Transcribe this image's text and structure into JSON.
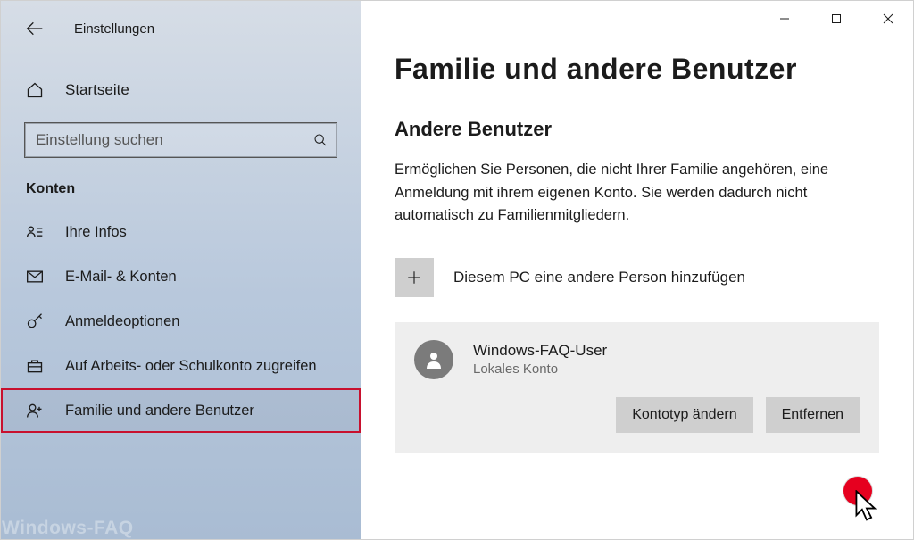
{
  "window": {
    "title": "Einstellungen"
  },
  "sidebar": {
    "home": "Startseite",
    "searchPlaceholder": "Einstellung suchen",
    "sectionLabel": "Konten",
    "items": [
      {
        "label": "Ihre Infos"
      },
      {
        "label": "E-Mail- & Konten"
      },
      {
        "label": "Anmeldeoptionen"
      },
      {
        "label": "Auf Arbeits- oder Schulkonto zugreifen"
      },
      {
        "label": "Familie und andere Benutzer"
      }
    ]
  },
  "main": {
    "heading": "Familie und andere Benutzer",
    "section": "Andere Benutzer",
    "description": "Ermöglichen Sie Personen, die nicht Ihrer Familie angehören, eine Anmeldung mit ihrem eigenen Konto. Sie werden dadurch nicht automatisch zu Familienmitgliedern.",
    "addPerson": "Diesem PC eine andere Person hinzufügen",
    "user": {
      "name": "Windows-FAQ-User",
      "type": "Lokales Konto"
    },
    "actions": {
      "changeType": "Kontotyp ändern",
      "remove": "Entfernen"
    }
  },
  "watermark": "Windows-FAQ"
}
